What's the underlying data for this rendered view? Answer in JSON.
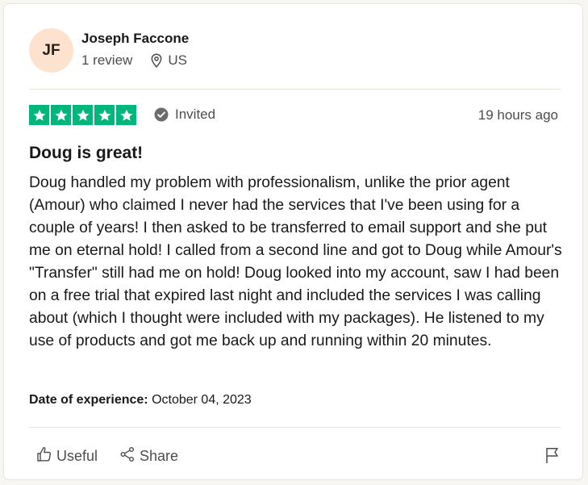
{
  "reviewer": {
    "initials": "JF",
    "name": "Joseph Faccone",
    "review_count": "1 review",
    "country": "US"
  },
  "review": {
    "rating": 5,
    "status": "Invited",
    "posted": "19 hours ago",
    "title": "Doug is great!",
    "body": "Doug handled my problem with professionalism, unlike the prior agent (Amour) who claimed I never had the services that I've been using for a couple of years! I then asked to be transferred to email support and she put me on eternal hold! I called from a second line and got to Doug while Amour's \"Transfer\" still had me on hold! Doug looked into my account, saw I had been on a free trial that expired last night and included the services I was calling about (which I thought were included with my packages). He listened to my use of products and got me back up and running within 20 minutes.",
    "experience_label": "Date of experience:",
    "experience_date": "October 04, 2023"
  },
  "actions": {
    "useful_label": "Useful",
    "share_label": "Share"
  },
  "icons": {
    "location": "location-pin-icon",
    "invited": "check-circle-icon",
    "useful": "thumbs-up-icon",
    "share": "share-icon",
    "report": "flag-icon",
    "star": "star-icon"
  },
  "colors": {
    "star_bg": "#00b67a",
    "avatar_bg": "#fde3cf"
  }
}
